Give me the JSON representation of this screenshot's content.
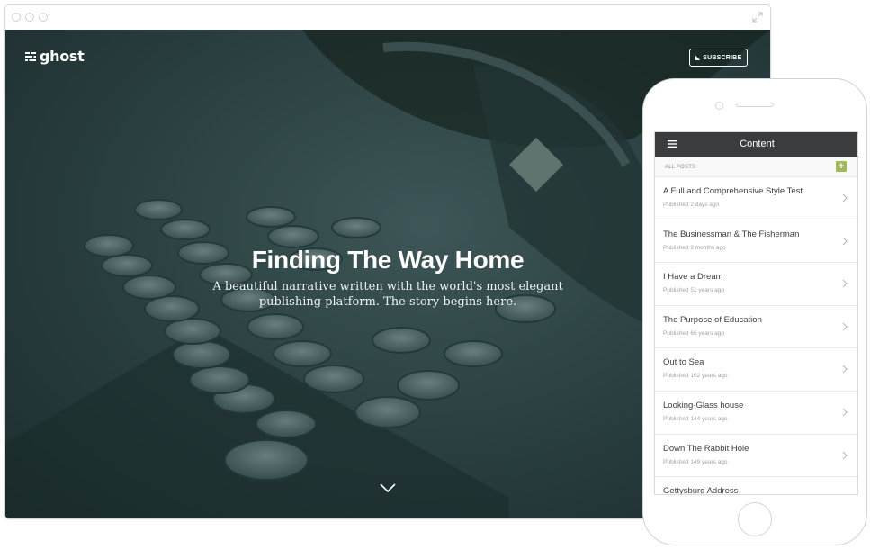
{
  "desktop": {
    "logo_text": "ghost",
    "subscribe_label": "SUBSCRIBE",
    "hero_title": "Finding The Way Home",
    "hero_subtitle": "A beautiful narrative written with the world's most elegant publishing platform. The story begins here.",
    "icons": [
      "ghost-logo-icon",
      "rss-icon",
      "chevron-down-icon",
      "expand-icon"
    ]
  },
  "mobile": {
    "header_title": "Content",
    "section_label": "ALL POSTS",
    "add_label": "+",
    "posts": [
      {
        "title": "A Full and Comprehensive Style Test",
        "meta": "Published 2 days ago"
      },
      {
        "title": "The Businessman & The Fisherman",
        "meta": "Published 2 months ago"
      },
      {
        "title": "I Have a Dream",
        "meta": "Published 51 years ago"
      },
      {
        "title": "The Purpose of Education",
        "meta": "Published 66 years ago"
      },
      {
        "title": "Out to Sea",
        "meta": "Published 102 years ago"
      },
      {
        "title": "Looking-Glass house",
        "meta": "Published 144 years ago"
      },
      {
        "title": "Down The Rabbit Hole",
        "meta": "Published 149 years ago"
      },
      {
        "title": "Gettysburg Address",
        "meta": ""
      }
    ]
  },
  "colors": {
    "hero_overlay": "#2c4243",
    "mobile_header": "#3a3c3d",
    "add_button": "#9fbb58"
  }
}
